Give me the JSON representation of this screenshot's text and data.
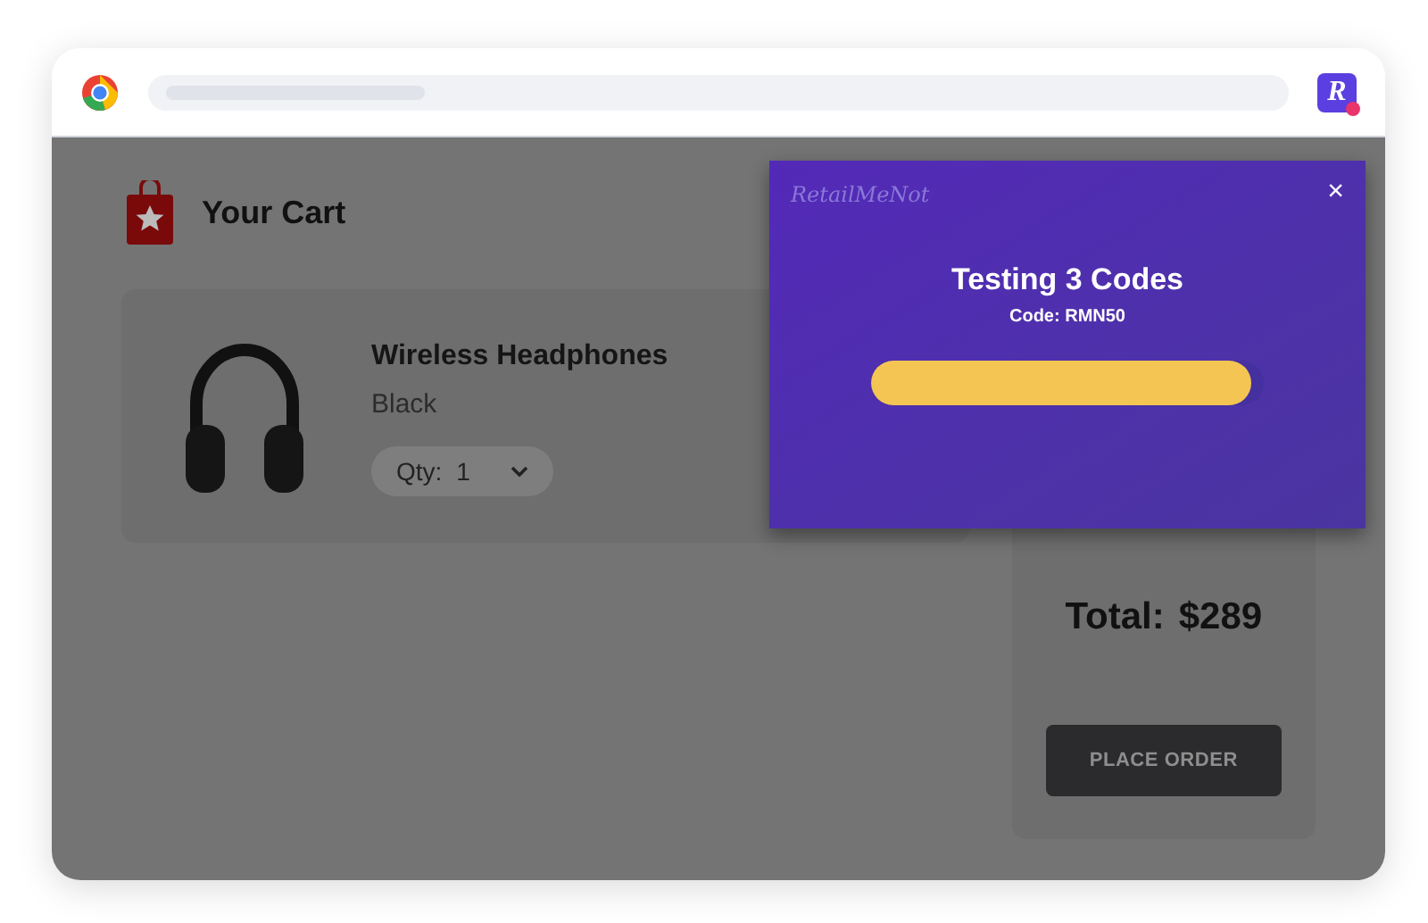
{
  "browser": {
    "extension_badge": "R",
    "extension_notification": true
  },
  "cart": {
    "title": "Your Cart",
    "item": {
      "name": "Wireless Headphones",
      "variant": "Black",
      "qty_label": "Qty:",
      "qty_value": "1"
    }
  },
  "summary": {
    "total_label": "Total:",
    "total_value": "$289",
    "button": "PLACE ORDER"
  },
  "popup": {
    "logo": "RetailMeNot",
    "close": "×",
    "title": "Testing 3 Codes",
    "code": "Code: RMN50",
    "progress": {
      "level": 0.97
    }
  }
}
